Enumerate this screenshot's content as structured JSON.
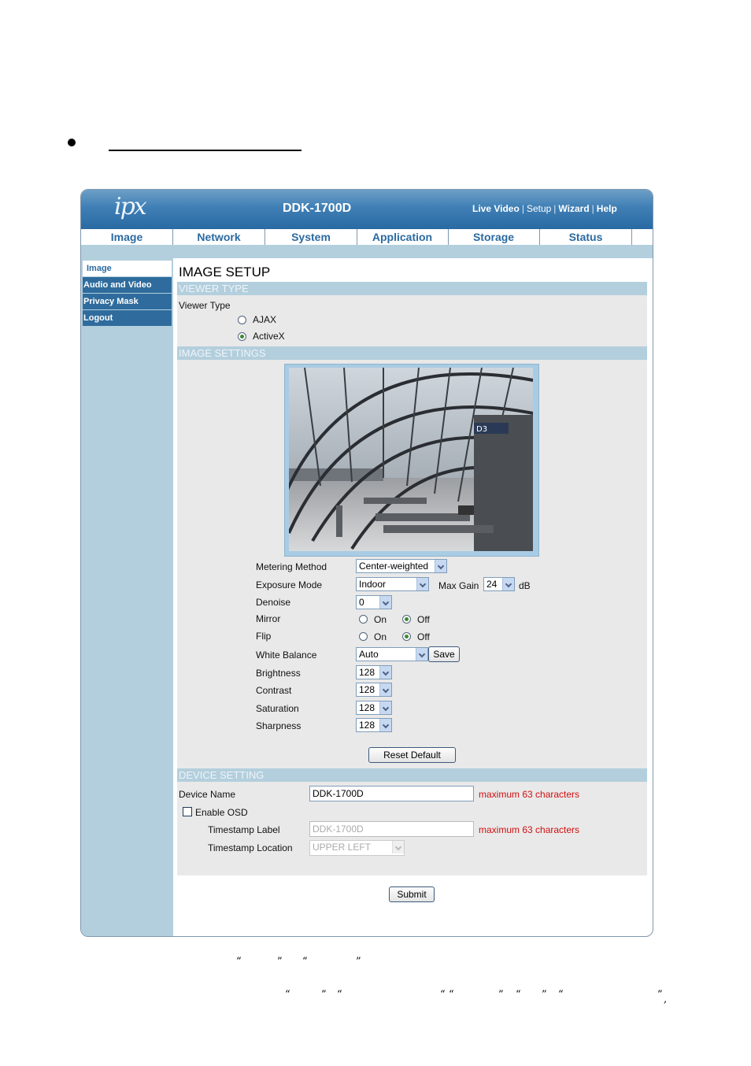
{
  "document": {
    "quote_line1": [
      "“",
      "”",
      "“",
      "”"
    ],
    "quote_line2": [
      "“",
      "”",
      "“",
      "“",
      "“",
      "”",
      "“",
      "”",
      "“",
      "”",
      ","
    ]
  },
  "app": {
    "logo": "ipx",
    "title": "DDK-1700D",
    "top_links": [
      "Live Video",
      "Setup",
      "Wizard",
      "Help"
    ],
    "tabs": [
      "Image",
      "Network",
      "System",
      "Application",
      "Storage",
      "Status"
    ],
    "sidebar": [
      "Image",
      "Audio and Video",
      "Privacy Mask",
      "Logout"
    ],
    "sidebar_active": "Image",
    "page_title": "IMAGE SETUP"
  },
  "viewer_type": {
    "header": "VIEWER TYPE",
    "label": "Viewer Type",
    "options": [
      "AJAX",
      "ActiveX"
    ],
    "selected": "ActiveX"
  },
  "image_settings": {
    "header": "IMAGE SETTINGS",
    "camera_sign": "D3",
    "metering_method": {
      "label": "Metering Method",
      "value": "Center-weighted"
    },
    "exposure_mode": {
      "label": "Exposure Mode",
      "value": "Indoor"
    },
    "max_gain": {
      "label": "Max Gain",
      "value": "24",
      "unit": "dB"
    },
    "denoise": {
      "label": "Denoise",
      "value": "0"
    },
    "mirror": {
      "label": "Mirror",
      "on": "On",
      "off": "Off",
      "selected": "Off"
    },
    "flip": {
      "label": "Flip",
      "on": "On",
      "off": "Off",
      "selected": "Off"
    },
    "white_balance": {
      "label": "White Balance",
      "value": "Auto",
      "save": "Save"
    },
    "brightness": {
      "label": "Brightness",
      "value": "128"
    },
    "contrast": {
      "label": "Contrast",
      "value": "128"
    },
    "saturation": {
      "label": "Saturation",
      "value": "128"
    },
    "sharpness": {
      "label": "Sharpness",
      "value": "128"
    },
    "reset": "Reset Default"
  },
  "device_setting": {
    "header": "DEVICE SETTING",
    "device_name": {
      "label": "Device Name",
      "value": "DDK-1700D",
      "hint": "maximum 63 characters"
    },
    "enable_osd": {
      "label": "Enable OSD",
      "checked": false
    },
    "timestamp_label": {
      "label": "Timestamp Label",
      "value": "DDK-1700D",
      "hint": "maximum 63 characters"
    },
    "timestamp_location": {
      "label": "Timestamp Location",
      "value": "UPPER LEFT"
    },
    "submit": "Submit"
  },
  "colors": {
    "header_blue": "#3f7fb5",
    "accent_light": "#b3cfdd",
    "tab_text": "#2b6aa1",
    "hint_red": "#d01010"
  }
}
